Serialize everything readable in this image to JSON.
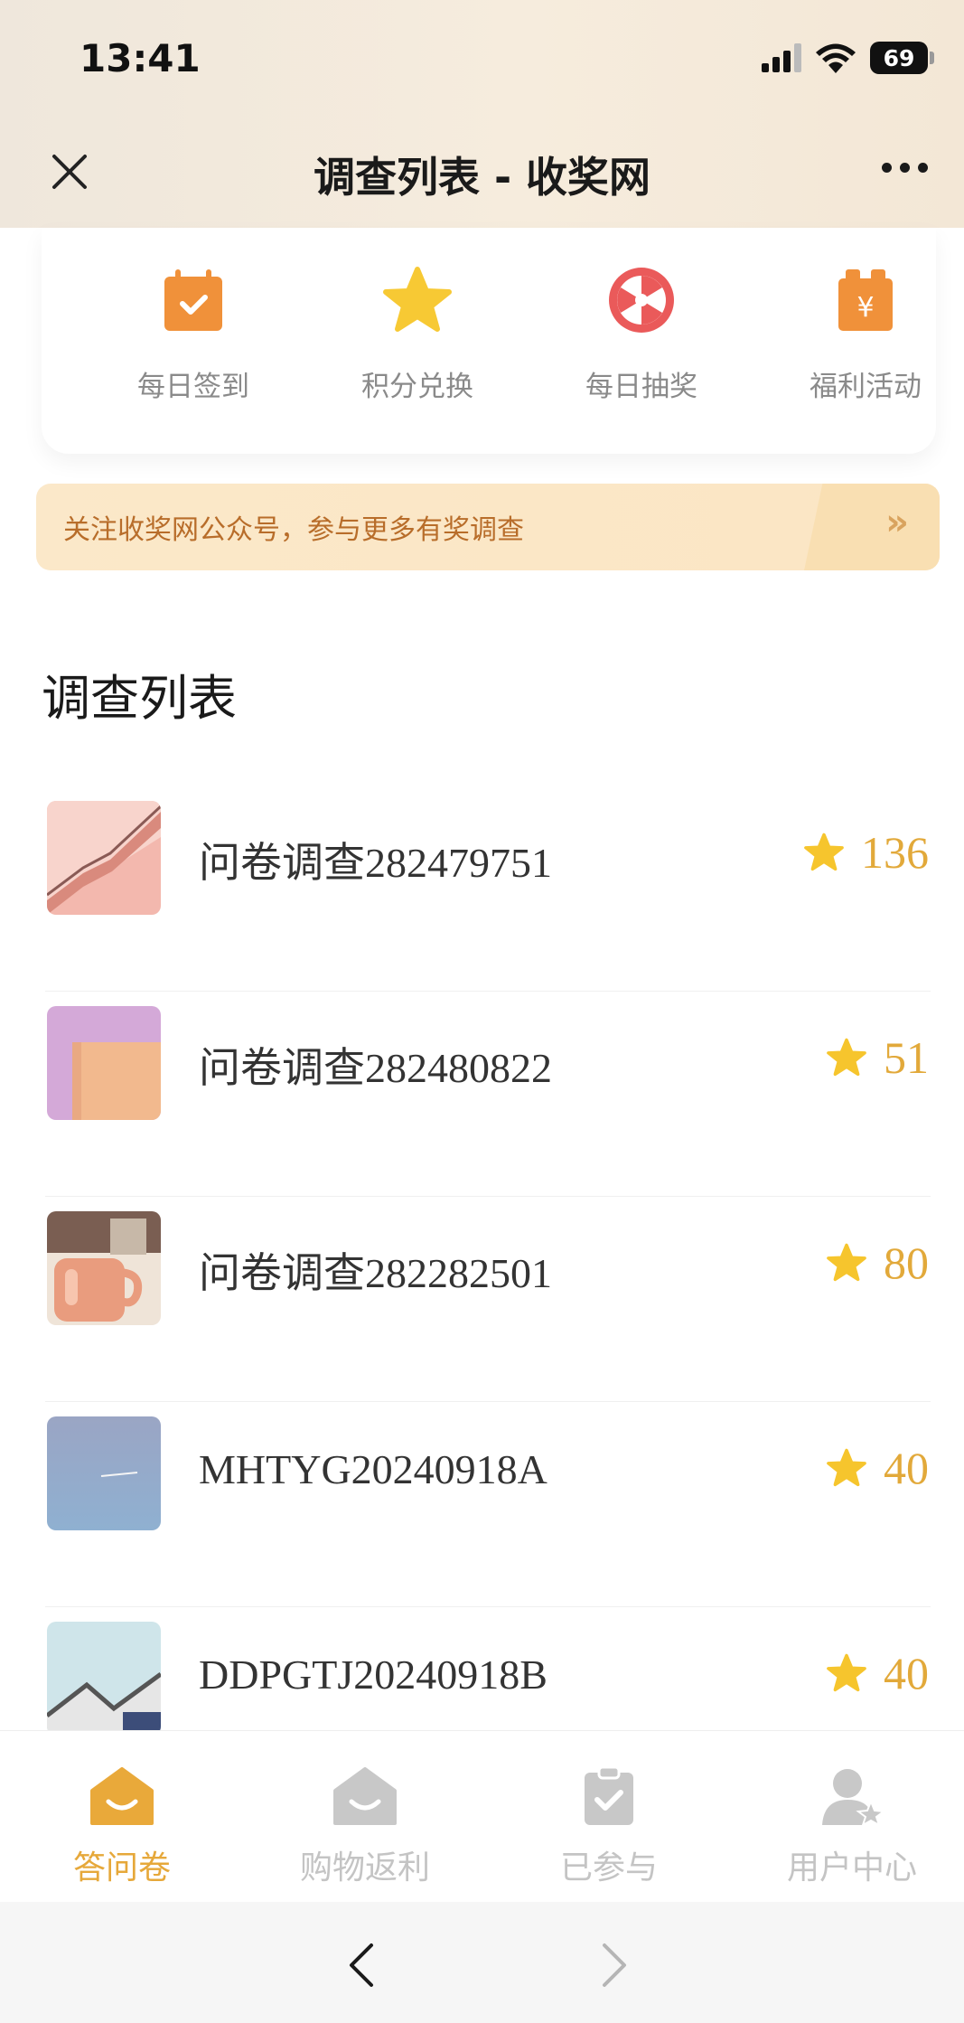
{
  "status": {
    "time": "13:41",
    "battery": "69"
  },
  "nav": {
    "title": "调查列表 - 收奖网"
  },
  "quick_actions": [
    {
      "label": "每日签到",
      "icon": "calendar-check-icon"
    },
    {
      "label": "积分兑换",
      "icon": "star-icon"
    },
    {
      "label": "每日抽奖",
      "icon": "lottery-wheel-icon"
    },
    {
      "label": "福利活动",
      "icon": "gift-bag-icon"
    }
  ],
  "banner": {
    "text": "关注收奖网公众号，参与更多有奖调查",
    "arrow": "»"
  },
  "section_title": "调查列表",
  "surveys": [
    {
      "name": "问卷调查282479751",
      "points": "136"
    },
    {
      "name": "问卷调查282480822",
      "points": "51"
    },
    {
      "name": "问卷调查282282501",
      "points": "80"
    },
    {
      "name": "MHTYG20240918A",
      "points": "40"
    },
    {
      "name": "DDPGTJ20240918B",
      "points": "40"
    }
  ],
  "tabs": [
    {
      "label": "答问卷",
      "active": true
    },
    {
      "label": "购物返利",
      "active": false
    },
    {
      "label": "已参与",
      "active": false
    },
    {
      "label": "用户中心",
      "active": false
    }
  ],
  "colors": {
    "accent": "#e6a83a",
    "inactive": "#c4c4c4",
    "banner_text": "#b86d2a"
  }
}
